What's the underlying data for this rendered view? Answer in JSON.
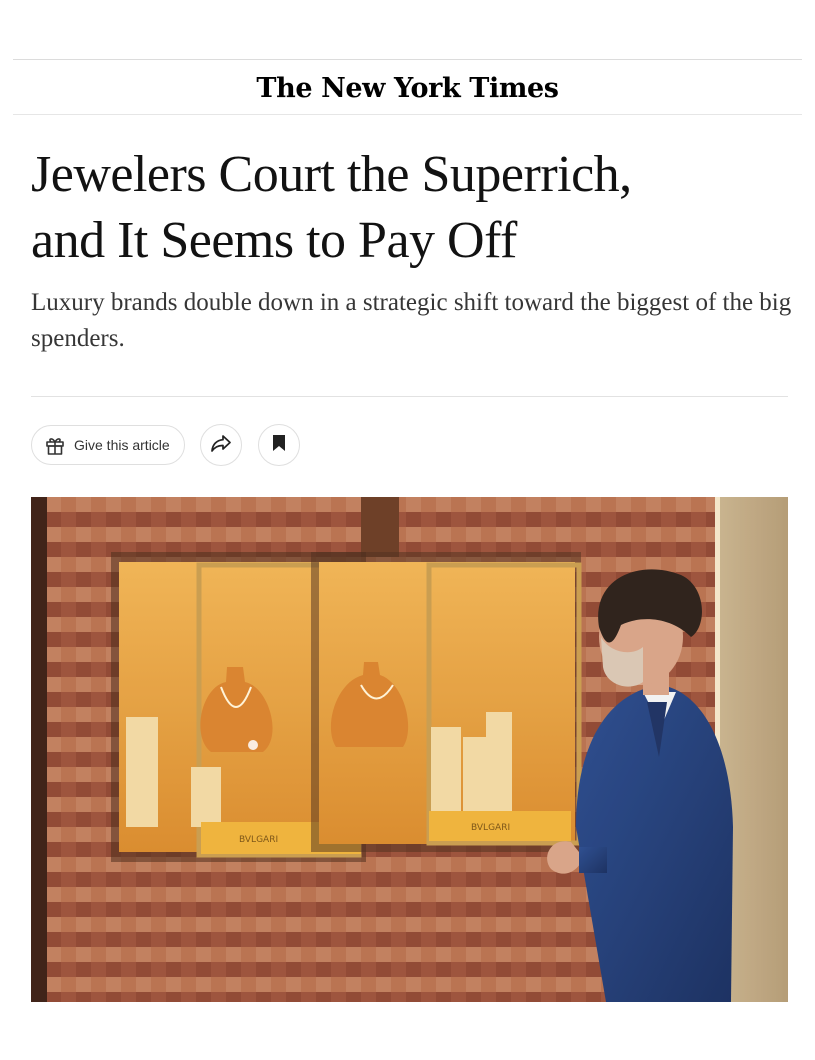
{
  "masthead": {
    "logo_text": "The New York Times"
  },
  "article": {
    "headline_line1": "Jewelers Court the Superrich,",
    "headline_line2": "and It Seems to Pay Off",
    "summary": "Luxury brands double down in a strategic shift toward the biggest of the big spenders."
  },
  "share_tools": {
    "gift_label": "Give this article",
    "gift_icon": "gift-icon",
    "share_icon": "share-arrow-icon",
    "save_icon": "bookmark-icon"
  },
  "hero_image": {
    "display_brand_text": "BVLGARI",
    "colors": {
      "wall": "#a6583a",
      "display_glow": "#e9a540",
      "suit": "#1e3c7a"
    }
  }
}
